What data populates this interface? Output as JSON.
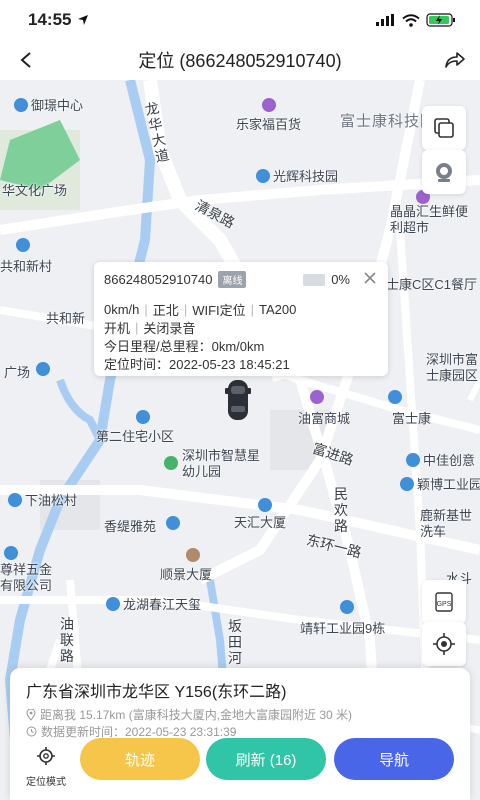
{
  "status": {
    "time": "14:55"
  },
  "nav": {
    "title": "定位 (866248052910740)"
  },
  "map": {
    "labels": {
      "yumao": "御璟中心",
      "lehua": "乐家福百货",
      "fushikang_park": "富士康科技园",
      "longhua_ave": "龙华大道",
      "huawen": "华文化广场",
      "guanghui": "光辉科技园",
      "qingquan": "清泉路",
      "pinpin": "晶晶汇生鲜便利超市",
      "gongheshe": "共和新村",
      "fushi_c": "士康C区C1餐厅",
      "gonghe2": "共和新",
      "guangchang": "广场",
      "shenzhen_park": "深圳市富士康园区",
      "youfu": "油富商城",
      "fushikang": "富士康",
      "dier": "第二住宅小区",
      "zhihui": "深圳市智慧星幼儿园",
      "fujin": "富进路",
      "zhongjia": "中佳创意",
      "yingbo": "颖博工业园",
      "xiadan": "下油松村",
      "minhuan": "民欢路",
      "tianhui": "天汇大厦",
      "lulu": "鹿新基世洗车",
      "xiangti": "香缇雅苑",
      "dongyuan": "东环一路",
      "zunxiang": "尊祥五金有限公司",
      "shunjing": "顺景大厦",
      "shuisheng": "水斗",
      "longhu": "龙湖春江天玺",
      "bantian": "坂田河",
      "jingxuan": "靖轩工业园9栋",
      "youlian": "油联路"
    }
  },
  "popup": {
    "imei": "866248052910740",
    "badge": "离线",
    "battery": "0%",
    "speed": "0km/h",
    "direction": "正北",
    "locate_type": "WIFI定位",
    "model": "TA200",
    "power": "开机",
    "record": "关闭录音",
    "mileage": "今日里程/总里程：0km/0km",
    "time": "定位时间：2022-05-23 18:45:21"
  },
  "panel": {
    "address": "广东省深圳市龙华区 Y156(东环二路)",
    "distance": "距离我 15.17km (富康科技大厦内,金地大富康园附近 30 米)",
    "updated": "数据更新时间：2022-05-23 23:31:39",
    "mode_label": "定位模式",
    "track_label": "轨迹",
    "refresh_label": "刷新 (16)",
    "navigate_label": "导航"
  },
  "colors": {
    "track": "#f5c64a",
    "refresh": "#2fc5a6",
    "navigate": "#4a66e8",
    "poi_blue": "#3f8fd9"
  }
}
